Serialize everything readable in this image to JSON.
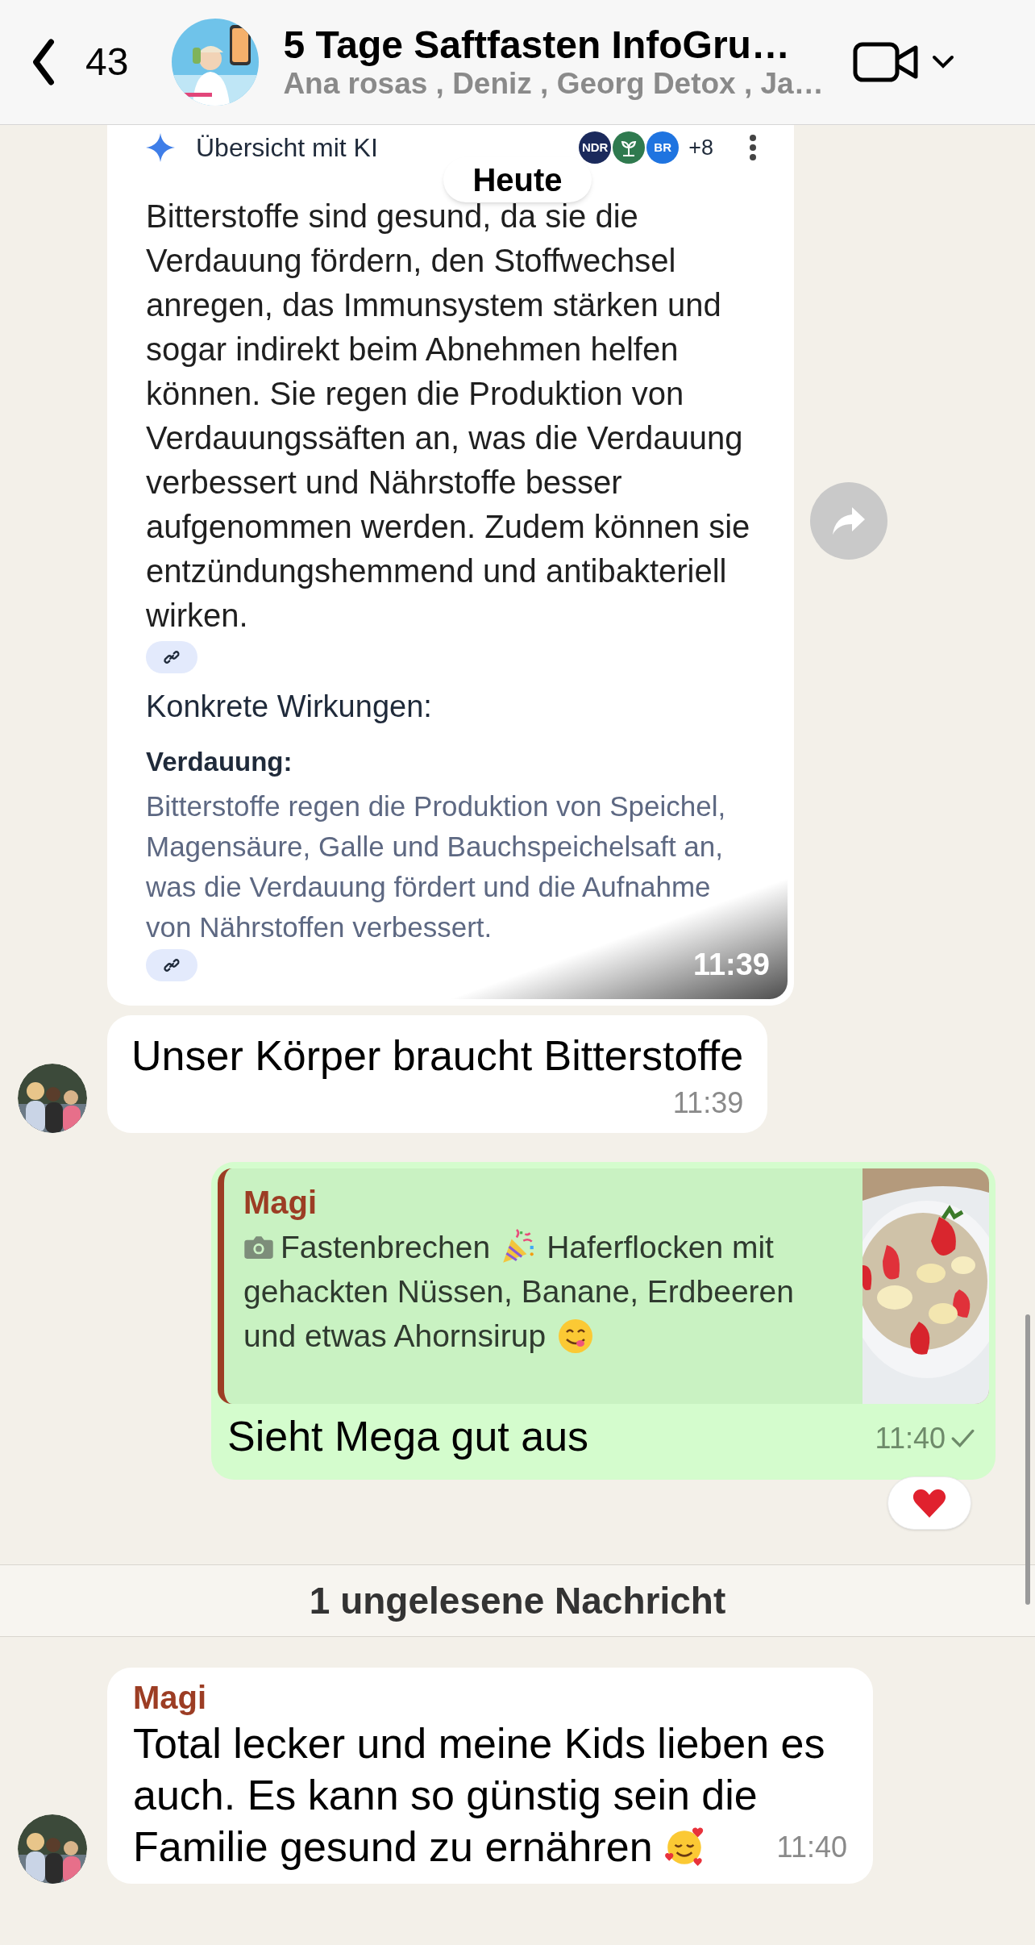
{
  "header": {
    "back_count": "43",
    "title": "5 Tage Saftfasten InfoGru…",
    "subtitle": "Ana rosas , Deniz , Georg Detox , Ja…"
  },
  "date_pill": "Heute",
  "messages": [
    {
      "kind": "screenshot",
      "avatar": false,
      "time": "11:39",
      "overview": {
        "title": "Übersicht mit KI",
        "sources": [
          {
            "kind": "text",
            "label": "NDR",
            "color": "#1b2a5c"
          },
          {
            "kind": "icon",
            "color": "#2f7a4f"
          },
          {
            "kind": "text",
            "label": "BR",
            "color": "#1f74e0"
          }
        ],
        "more": "+8",
        "paragraph": "Bitterstoffe sind gesund, da sie die Verdauung fördern, den Stoffwechsel anregen, das Immunsystem stärken und sogar indirekt beim Abnehmen helfen können. Sie regen die Produktion von Verdauungssäften an, was die Verdauung verbessert und Nährstoffe besser aufgenommen werden. Zudem können sie entzündungshemmend und antibakteriell wirken.",
        "heading": "Konkrete Wirkungen:",
        "subheading": "Verdauung:",
        "detail": "Bitterstoffe regen die Produktion von Speichel, Magensäure, Galle und Bauchspeichelsaft an, was die Verdauung fördert und die Aufnahme von Nährstoffen verbessert."
      }
    },
    {
      "kind": "text",
      "avatar": true,
      "lines": [
        [
          {
            "kind": "text",
            "text": "Unser Körper braucht Bitterstoffe"
          }
        ]
      ],
      "time": "11:39"
    },
    {
      "kind": "reply",
      "quote": {
        "sender": "Magi",
        "lines": [
          [
            {
              "kind": "camera"
            },
            {
              "kind": "text",
              "text": "Fastenbrechen"
            },
            {
              "kind": "party"
            },
            {
              "kind": "text",
              "text": "Haferflocken mit"
            }
          ],
          [
            {
              "kind": "text",
              "text": "gehackten Nüssen, Banane, Erdbeeren"
            }
          ],
          [
            {
              "kind": "text",
              "text": "und etwas Ahornsirup"
            },
            {
              "kind": "yum"
            }
          ]
        ]
      },
      "text": "Sieht Mega gut aus",
      "time": "11:40",
      "delivered": false,
      "reaction": {
        "kind": "heart"
      }
    },
    {
      "kind": "divider",
      "text": "1 ungelesene Nachricht"
    },
    {
      "kind": "sender_text",
      "avatar": true,
      "sender": "Magi",
      "lines": [
        [
          {
            "kind": "text",
            "text": "Total lecker und meine Kids lieben es auch. Es kann so günstig sein die"
          }
        ],
        [
          {
            "kind": "text",
            "text": "Familie gesund zu ernähren"
          },
          {
            "kind": "love"
          }
        ]
      ],
      "time": "11:40"
    }
  ]
}
